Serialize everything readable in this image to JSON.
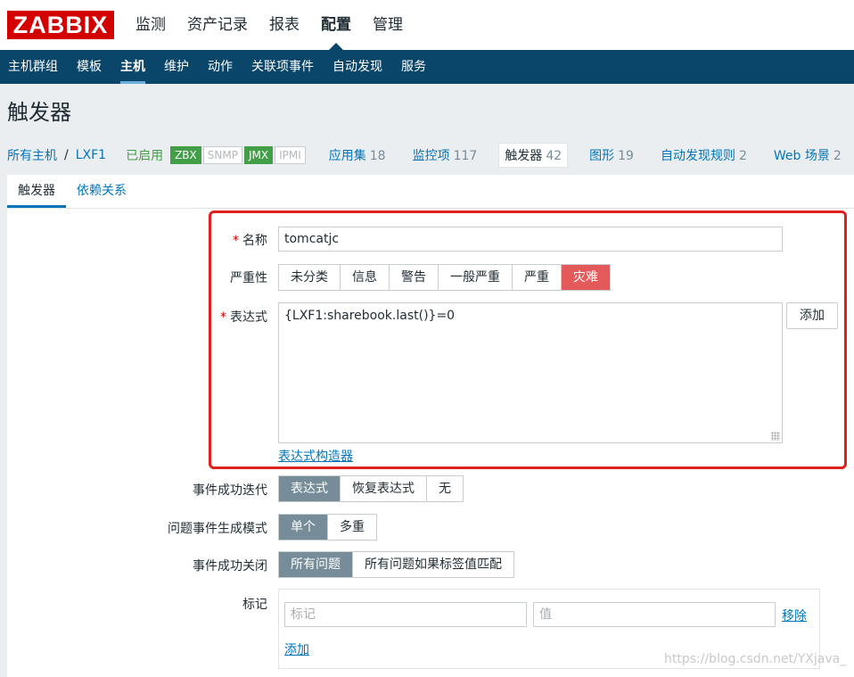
{
  "app": {
    "logo": "ZABBIX"
  },
  "main_nav": [
    {
      "label": "监测",
      "active": false
    },
    {
      "label": "资产记录",
      "active": false
    },
    {
      "label": "报表",
      "active": false
    },
    {
      "label": "配置",
      "active": true
    },
    {
      "label": "管理",
      "active": false
    }
  ],
  "sub_nav": [
    {
      "label": "主机群组",
      "active": false
    },
    {
      "label": "模板",
      "active": false
    },
    {
      "label": "主机",
      "active": true
    },
    {
      "label": "维护",
      "active": false
    },
    {
      "label": "动作",
      "active": false
    },
    {
      "label": "关联项事件",
      "active": false
    },
    {
      "label": "自动发现",
      "active": false
    },
    {
      "label": "服务",
      "active": false
    }
  ],
  "page_title": "触发器",
  "breadcrumbs": {
    "all_hosts": "所有主机",
    "separator": "/",
    "host": "LXF1",
    "status": "已启用",
    "availability": [
      {
        "label": "ZBX",
        "on": true
      },
      {
        "label": "SNMP",
        "on": false
      },
      {
        "label": "JMX",
        "on": true
      },
      {
        "label": "IPMI",
        "on": false
      }
    ],
    "tabs": [
      {
        "label": "应用集",
        "count": "18"
      },
      {
        "label": "监控项",
        "count": "117"
      },
      {
        "label": "触发器",
        "count": "42"
      },
      {
        "label": "图形",
        "count": "19"
      },
      {
        "label": "自动发现规则",
        "count": "2"
      },
      {
        "label": "Web 场景",
        "count": "2"
      }
    ]
  },
  "form_tabs": {
    "trigger": "触发器",
    "dependencies": "依赖关系"
  },
  "form": {
    "required_mark": "*",
    "name_label": "名称",
    "name_value": "tomcatjc",
    "severity_label": "严重性",
    "severity_options": [
      "未分类",
      "信息",
      "警告",
      "一般严重",
      "严重",
      "灾难"
    ],
    "severity_selected": "灾难",
    "expression_label": "表达式",
    "expression_value": "{LXF1:sharebook.last()}=0",
    "add_button": "添加",
    "expression_constructor": "表达式构造器",
    "ok_event_gen_label": "事件成功迭代",
    "ok_event_gen_options": [
      "表达式",
      "恢复表达式",
      "无"
    ],
    "ok_event_gen_selected": "表达式",
    "problem_mode_label": "问题事件生成模式",
    "problem_mode_options": [
      "单个",
      "多重"
    ],
    "problem_mode_selected": "单个",
    "ok_close_label": "事件成功关闭",
    "ok_close_options": [
      "所有问题",
      "所有问题如果标签值匹配"
    ],
    "ok_close_selected": "所有问题",
    "tags_label": "标记",
    "tag_placeholder": "标记",
    "value_placeholder": "值",
    "remove_link": "移除",
    "add_link": "添加"
  },
  "watermark": "https://blog.csdn.net/YXjava_",
  "colors": {
    "brand": "#d40000",
    "nav": "#0a466a",
    "link": "#0275b8",
    "enabled": "#429e47",
    "disaster": "#e45959",
    "selected": "#768d99",
    "highlight": "#e0201c"
  }
}
